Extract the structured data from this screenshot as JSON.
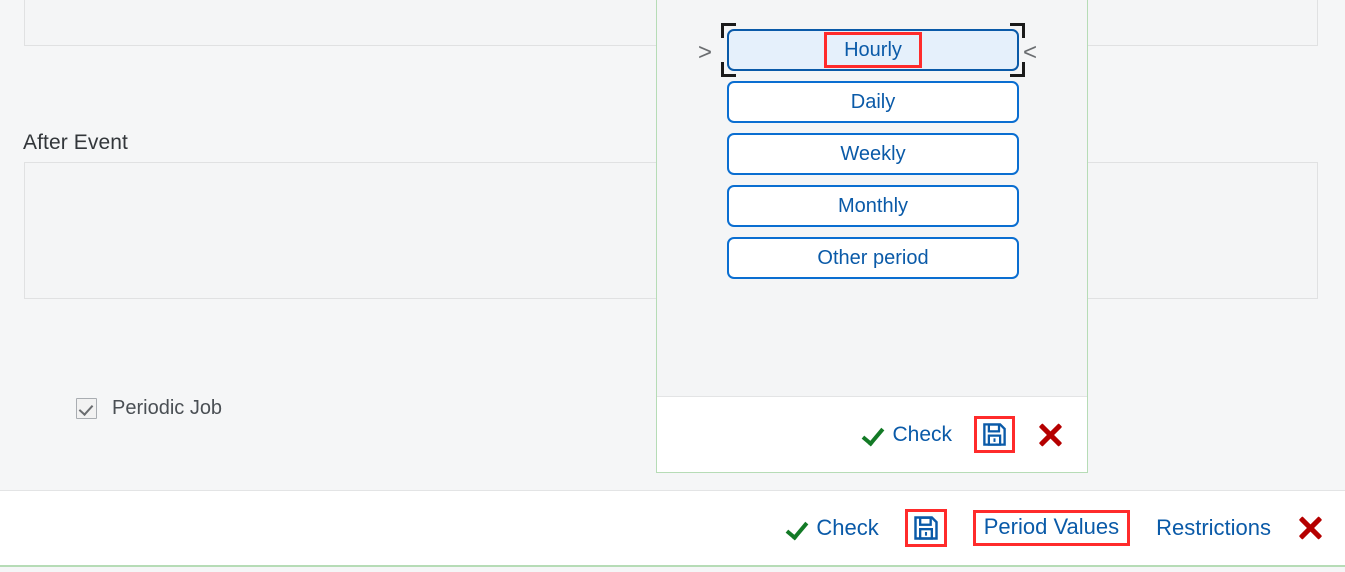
{
  "form": {
    "after_event_label": "After Event",
    "periodic_job": {
      "label": "Periodic Job",
      "checked": true,
      "check_icon": "checkmark-icon"
    }
  },
  "period_dialog": {
    "nav": {
      "prev_icon": ">",
      "next_icon": "<"
    },
    "options": [
      {
        "label": "Hourly",
        "selected": true,
        "highlighted": true
      },
      {
        "label": "Daily",
        "selected": false,
        "highlighted": false
      },
      {
        "label": "Weekly",
        "selected": false,
        "highlighted": false
      },
      {
        "label": "Monthly",
        "selected": false,
        "highlighted": false
      },
      {
        "label": "Other period",
        "selected": false,
        "highlighted": false
      }
    ],
    "footer": {
      "check_label": "Check",
      "check_icon": "checkmark-icon",
      "save_icon": "save-floppy-icon",
      "save_highlighted": true,
      "close_icon": "close-x-icon"
    }
  },
  "bottom_toolbar": {
    "check_label": "Check",
    "check_icon": "checkmark-icon",
    "save_icon": "save-floppy-icon",
    "save_highlighted": true,
    "period_values_label": "Period Values",
    "period_values_highlighted": true,
    "restrictions_label": "Restrictions",
    "close_icon": "close-x-icon"
  },
  "colors": {
    "accent_blue": "#0a5aa8",
    "border_blue": "#0a6ed1",
    "selected_fill": "#e5f0fb",
    "annotation_red": "#ff2b2b",
    "check_green": "#137a26",
    "close_red": "#b50000",
    "dialog_border_green": "#b6dcb6",
    "page_background": "#f5f6f7"
  }
}
